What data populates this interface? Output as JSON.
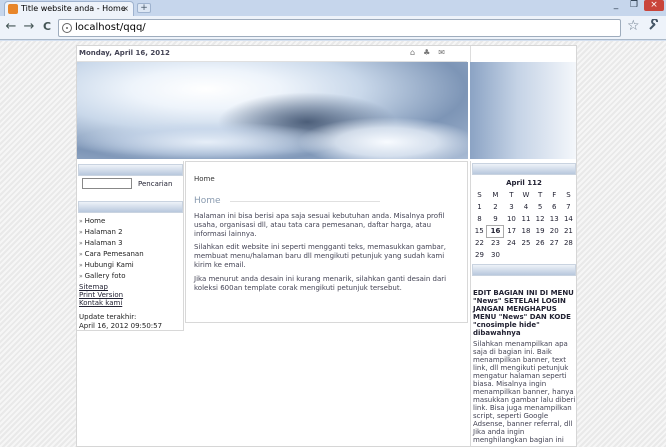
{
  "browser": {
    "tab_title": "Title website anda - Home",
    "tab_close": "×",
    "new_tab": "+",
    "window_buttons": [
      "_",
      "❐",
      "×"
    ],
    "back": "←",
    "forward": "→",
    "reload": "C",
    "url": "localhost/qqq/",
    "bookmark_icon": "☆",
    "menu_icon": "wrench-icon"
  },
  "site": {
    "date": "Monday, April 16, 2012",
    "top_icons": [
      "home-icon",
      "sitemap-icon",
      "mail-icon"
    ],
    "search_label": "Pencarian",
    "menu": [
      "Home",
      "Halaman 2",
      "Halaman 3",
      "Cara Pemesanan",
      "Hubungi Kami",
      "Gallery foto"
    ],
    "links": [
      "Sitemap",
      "Print Version",
      "Kontak kami"
    ],
    "update_label": "Update terakhir:",
    "update_value": "April 16, 2012 09:50:57",
    "breadcrumb": "Home",
    "title": "Home",
    "paragraphs": [
      "Halaman ini bisa berisi apa saja sesuai kebutuhan anda. Misalnya profil usaha, organisasi dll, atau tata cara pemesanan, daftar harga, atau informasi lainnya.",
      "Silahkan edit website ini seperti mengganti teks, memasukkan gambar, membuat menu/halaman baru dll mengikuti petunjuk yang sudah kami kirim ke email.",
      "Jika menurut anda desain ini kurang menarik, silahkan ganti desain dari koleksi 600an template corak mengikuti petunjuk tersebut."
    ],
    "calendar": {
      "title": "April 112",
      "days": [
        "S",
        "M",
        "T",
        "W",
        "T",
        "F",
        "S"
      ],
      "weeks": [
        [
          "1",
          "2",
          "3",
          "4",
          "5",
          "6",
          "7"
        ],
        [
          "8",
          "9",
          "10",
          "11",
          "12",
          "13",
          "14"
        ],
        [
          "15",
          "16",
          "17",
          "18",
          "19",
          "20",
          "21"
        ],
        [
          "22",
          "23",
          "24",
          "25",
          "26",
          "27",
          "28"
        ],
        [
          "29",
          "30",
          "",
          "",
          "",
          "",
          ""
        ]
      ],
      "today": "16"
    },
    "right_title": "EDIT BAGIAN INI DI MENU \"News\" SETELAH LOGIN JANGAN MENGHAPUS MENU \"News\" DAN KODE \"cnosimple hide\" dibawahnya",
    "right_text": "Silahkan menampilkan apa saja di bagian ini. Baik menampilkan banner, text link, dll mengikuti petunjuk mengatur halaman seperti biasa. Misalnya ingin menampilkan banner, hanya masukkan gambar lalu diberi link. Bisa juga menampilkan script, seperti Google Adsense, banner referral, dll Jika anda ingin menghilangkan bagian ini"
  }
}
